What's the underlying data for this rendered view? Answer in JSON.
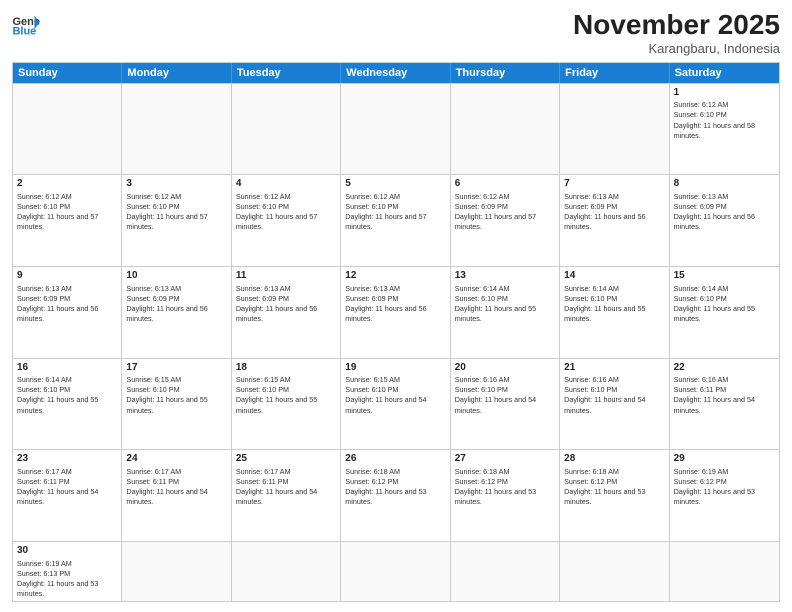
{
  "header": {
    "logo_general": "General",
    "logo_blue": "Blue",
    "month_title": "November 2025",
    "subtitle": "Karangbaru, Indonesia"
  },
  "calendar": {
    "days": [
      "Sunday",
      "Monday",
      "Tuesday",
      "Wednesday",
      "Thursday",
      "Friday",
      "Saturday"
    ],
    "weeks": [
      [
        {
          "day": "",
          "empty": true
        },
        {
          "day": "",
          "empty": true
        },
        {
          "day": "",
          "empty": true
        },
        {
          "day": "",
          "empty": true
        },
        {
          "day": "",
          "empty": true
        },
        {
          "day": "",
          "empty": true
        },
        {
          "day": "1",
          "sunrise": "Sunrise: 6:12 AM",
          "sunset": "Sunset: 6:10 PM",
          "daylight": "Daylight: 11 hours and 58 minutes."
        }
      ],
      [
        {
          "day": "2",
          "sunrise": "Sunrise: 6:12 AM",
          "sunset": "Sunset: 6:10 PM",
          "daylight": "Daylight: 11 hours and 57 minutes."
        },
        {
          "day": "3",
          "sunrise": "Sunrise: 6:12 AM",
          "sunset": "Sunset: 6:10 PM",
          "daylight": "Daylight: 11 hours and 57 minutes."
        },
        {
          "day": "4",
          "sunrise": "Sunrise: 6:12 AM",
          "sunset": "Sunset: 6:10 PM",
          "daylight": "Daylight: 11 hours and 57 minutes."
        },
        {
          "day": "5",
          "sunrise": "Sunrise: 6:12 AM",
          "sunset": "Sunset: 6:10 PM",
          "daylight": "Daylight: 11 hours and 57 minutes."
        },
        {
          "day": "6",
          "sunrise": "Sunrise: 6:12 AM",
          "sunset": "Sunset: 6:09 PM",
          "daylight": "Daylight: 11 hours and 57 minutes."
        },
        {
          "day": "7",
          "sunrise": "Sunrise: 6:13 AM",
          "sunset": "Sunset: 6:09 PM",
          "daylight": "Daylight: 11 hours and 56 minutes."
        },
        {
          "day": "8",
          "sunrise": "Sunrise: 6:13 AM",
          "sunset": "Sunset: 6:09 PM",
          "daylight": "Daylight: 11 hours and 56 minutes."
        }
      ],
      [
        {
          "day": "9",
          "sunrise": "Sunrise: 6:13 AM",
          "sunset": "Sunset: 6:09 PM",
          "daylight": "Daylight: 11 hours and 56 minutes."
        },
        {
          "day": "10",
          "sunrise": "Sunrise: 6:13 AM",
          "sunset": "Sunset: 6:09 PM",
          "daylight": "Daylight: 11 hours and 56 minutes."
        },
        {
          "day": "11",
          "sunrise": "Sunrise: 6:13 AM",
          "sunset": "Sunset: 6:09 PM",
          "daylight": "Daylight: 11 hours and 56 minutes."
        },
        {
          "day": "12",
          "sunrise": "Sunrise: 6:13 AM",
          "sunset": "Sunset: 6:09 PM",
          "daylight": "Daylight: 11 hours and 56 minutes."
        },
        {
          "day": "13",
          "sunrise": "Sunrise: 6:14 AM",
          "sunset": "Sunset: 6:10 PM",
          "daylight": "Daylight: 11 hours and 55 minutes."
        },
        {
          "day": "14",
          "sunrise": "Sunrise: 6:14 AM",
          "sunset": "Sunset: 6:10 PM",
          "daylight": "Daylight: 11 hours and 55 minutes."
        },
        {
          "day": "15",
          "sunrise": "Sunrise: 6:14 AM",
          "sunset": "Sunset: 6:10 PM",
          "daylight": "Daylight: 11 hours and 55 minutes."
        }
      ],
      [
        {
          "day": "16",
          "sunrise": "Sunrise: 6:14 AM",
          "sunset": "Sunset: 6:10 PM",
          "daylight": "Daylight: 11 hours and 55 minutes."
        },
        {
          "day": "17",
          "sunrise": "Sunrise: 6:15 AM",
          "sunset": "Sunset: 6:10 PM",
          "daylight": "Daylight: 11 hours and 55 minutes."
        },
        {
          "day": "18",
          "sunrise": "Sunrise: 6:15 AM",
          "sunset": "Sunset: 6:10 PM",
          "daylight": "Daylight: 11 hours and 55 minutes."
        },
        {
          "day": "19",
          "sunrise": "Sunrise: 6:15 AM",
          "sunset": "Sunset: 6:10 PM",
          "daylight": "Daylight: 11 hours and 54 minutes."
        },
        {
          "day": "20",
          "sunrise": "Sunrise: 6:16 AM",
          "sunset": "Sunset: 6:10 PM",
          "daylight": "Daylight: 11 hours and 54 minutes."
        },
        {
          "day": "21",
          "sunrise": "Sunrise: 6:16 AM",
          "sunset": "Sunset: 6:10 PM",
          "daylight": "Daylight: 11 hours and 54 minutes."
        },
        {
          "day": "22",
          "sunrise": "Sunrise: 6:16 AM",
          "sunset": "Sunset: 6:11 PM",
          "daylight": "Daylight: 11 hours and 54 minutes."
        }
      ],
      [
        {
          "day": "23",
          "sunrise": "Sunrise: 6:17 AM",
          "sunset": "Sunset: 6:11 PM",
          "daylight": "Daylight: 11 hours and 54 minutes."
        },
        {
          "day": "24",
          "sunrise": "Sunrise: 6:17 AM",
          "sunset": "Sunset: 6:11 PM",
          "daylight": "Daylight: 11 hours and 54 minutes."
        },
        {
          "day": "25",
          "sunrise": "Sunrise: 6:17 AM",
          "sunset": "Sunset: 6:11 PM",
          "daylight": "Daylight: 11 hours and 54 minutes."
        },
        {
          "day": "26",
          "sunrise": "Sunrise: 6:18 AM",
          "sunset": "Sunset: 6:12 PM",
          "daylight": "Daylight: 11 hours and 53 minutes."
        },
        {
          "day": "27",
          "sunrise": "Sunrise: 6:18 AM",
          "sunset": "Sunset: 6:12 PM",
          "daylight": "Daylight: 11 hours and 53 minutes."
        },
        {
          "day": "28",
          "sunrise": "Sunrise: 6:18 AM",
          "sunset": "Sunset: 6:12 PM",
          "daylight": "Daylight: 11 hours and 53 minutes."
        },
        {
          "day": "29",
          "sunrise": "Sunrise: 6:19 AM",
          "sunset": "Sunset: 6:12 PM",
          "daylight": "Daylight: 11 hours and 53 minutes."
        }
      ],
      [
        {
          "day": "30",
          "sunrise": "Sunrise: 6:19 AM",
          "sunset": "Sunset: 6:13 PM",
          "daylight": "Daylight: 11 hours and 53 minutes."
        },
        {
          "day": "",
          "empty": true
        },
        {
          "day": "",
          "empty": true
        },
        {
          "day": "",
          "empty": true
        },
        {
          "day": "",
          "empty": true
        },
        {
          "day": "",
          "empty": true
        },
        {
          "day": "",
          "empty": true
        }
      ]
    ]
  }
}
